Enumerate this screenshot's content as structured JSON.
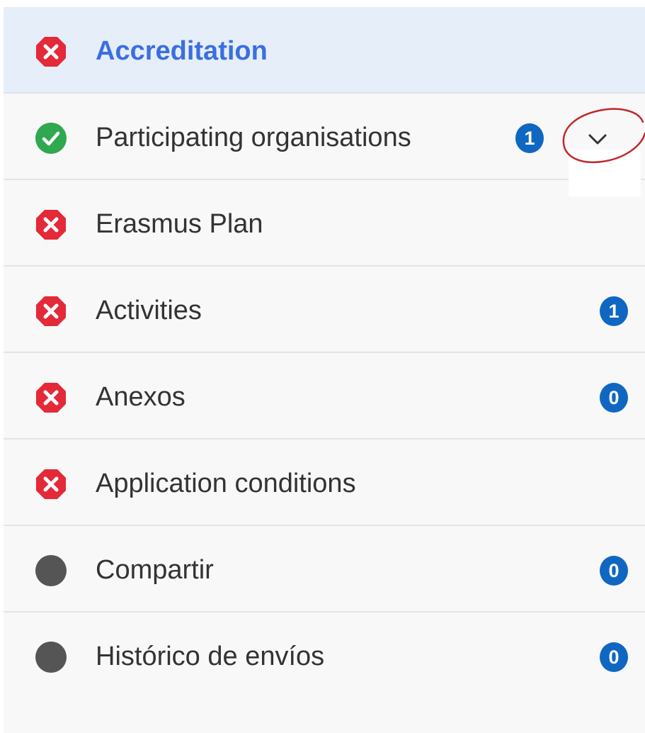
{
  "nav": {
    "items": [
      {
        "label": "Accreditation",
        "status": "error",
        "active": true
      },
      {
        "label": "Participating organisations",
        "status": "complete",
        "count": "1",
        "expandable": true
      },
      {
        "label": "Erasmus Plan",
        "status": "error"
      },
      {
        "label": "Activities",
        "status": "error",
        "count": "1"
      },
      {
        "label": "Anexos",
        "status": "error",
        "count": "0"
      },
      {
        "label": "Application conditions",
        "status": "error"
      },
      {
        "label": "Compartir",
        "status": "neutral",
        "count": "0"
      },
      {
        "label": "Histórico de envíos",
        "status": "neutral",
        "count": "0"
      }
    ]
  },
  "icons": {
    "error": "error-octagon-icon",
    "complete": "check-circle-icon",
    "neutral": "grey-dot-icon",
    "expand": "chevron-down-icon"
  },
  "colors": {
    "error": "#e42938",
    "complete": "#2fa84f",
    "neutral": "#555555",
    "badge": "#0f67c2",
    "active_text": "#3b6fe0",
    "annotation": "#c0282d"
  }
}
